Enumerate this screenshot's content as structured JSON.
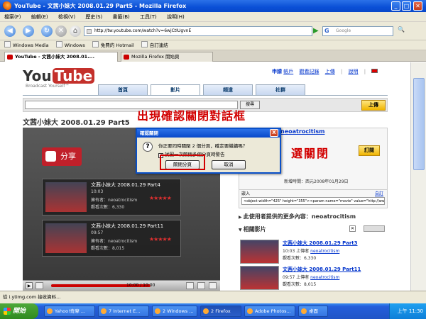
{
  "window": {
    "title": "YouTube - 文茜小妹大 2008.01.29 Part5 - Mozilla Firefox"
  },
  "menu": [
    "檔案(F)",
    "編輯(E)",
    "檢視(V)",
    "歷史(S)",
    "書籤(B)",
    "工具(T)",
    "說明(H)"
  ],
  "nav": {
    "url": "http://tw.youtube.com/watch?v=6wjCtIUgvnE",
    "search_placeholder": "Google",
    "search_engine_icon": "G"
  },
  "bookmarks": [
    "Windows Media",
    "Windows",
    "免費的 Hotmail",
    "自訂連結"
  ],
  "tabs": [
    {
      "label": "YouTube - 文茜小妹大 2008.01....",
      "active": true
    },
    {
      "label": "Mozilla Firefox 開始頁",
      "active": false
    }
  ],
  "youtube": {
    "logo_you": "You",
    "logo_tube": "Tube",
    "tagline": "Broadcast Yourself™",
    "toplinks": [
      "申請",
      "帳戶",
      "觀看記錄",
      "上傳",
      "|",
      "說明",
      "|"
    ],
    "main_tabs": [
      "首頁",
      "影片",
      "頻道",
      "社群"
    ],
    "search_btn": "搜尋",
    "upload_btn": "上傳",
    "video_title": "文茜小妹大 2008.01.29 Part5",
    "share_label": "分享",
    "player_related": [
      {
        "title": "文茜小妹大 2008.01.29 Part4",
        "duration": "10:03",
        "owner_label": "擁有者：",
        "owner": "neoatrocitism",
        "views_label": "觀看次數：",
        "views": "6,330"
      },
      {
        "title": "文茜小妹大 2008.01.29 Part11",
        "duration": "09:57",
        "owner_label": "擁有者：",
        "owner": "neoatrocitism",
        "views_label": "觀看次數：",
        "views": "8,015"
      }
    ],
    "stars": "★★★★★",
    "player_time": "10:00 / 10:00",
    "play_progress": 1.0,
    "uploader": "neoatrocitism",
    "subscribe_btn": "訂閱",
    "added_label": "新增時間：西元2008年01月29日",
    "embed_label": "嵌入",
    "embed_custom": "自訂",
    "embed_code": "<object width=\"425\" height=\"355\"><param name=\"movie\" value=\"http://www.yout",
    "more_from_user": "此使用者提供的更多內容：neoatrocitism",
    "related_header": "相關影片",
    "related_list": [
      {
        "title": "文茜小妹大 2008.01.29 Part3",
        "duration": "10:03",
        "owner_prefix": "上傳者",
        "owner": "neoatrocitism",
        "views_label": "觀看次數：",
        "views": "6,330"
      },
      {
        "title": "文茜小妹大 2008.01.29 Part11",
        "duration": "09:57",
        "owner_prefix": "上傳者",
        "owner": "neoatrocitism",
        "views_label": "觀看次數：",
        "views": "8,015"
      }
    ]
  },
  "dialog": {
    "title": "確認關閉",
    "message": "你正要同時關閉 2 個分頁，確定要繼續嗎？",
    "checkbox_label": "試圖一次關閉多個分頁時警告",
    "checkbox_checked": "✓",
    "close_tabs_btn": "關閉分頁",
    "cancel_btn": "取消",
    "close_x": "X"
  },
  "annotations": {
    "top": "出現確認關閉對話框",
    "right": "選關閉"
  },
  "status": "從 i.ytimg.com 接收資料...",
  "taskbar": {
    "start": "開始",
    "tasks": [
      "Yahoo!奇摩 ...",
      "7 Internet E...",
      "2 Windows ...",
      "2 Firefox",
      "Adobe Photos...",
      "桌面"
    ],
    "clock": "上午 11:30"
  }
}
